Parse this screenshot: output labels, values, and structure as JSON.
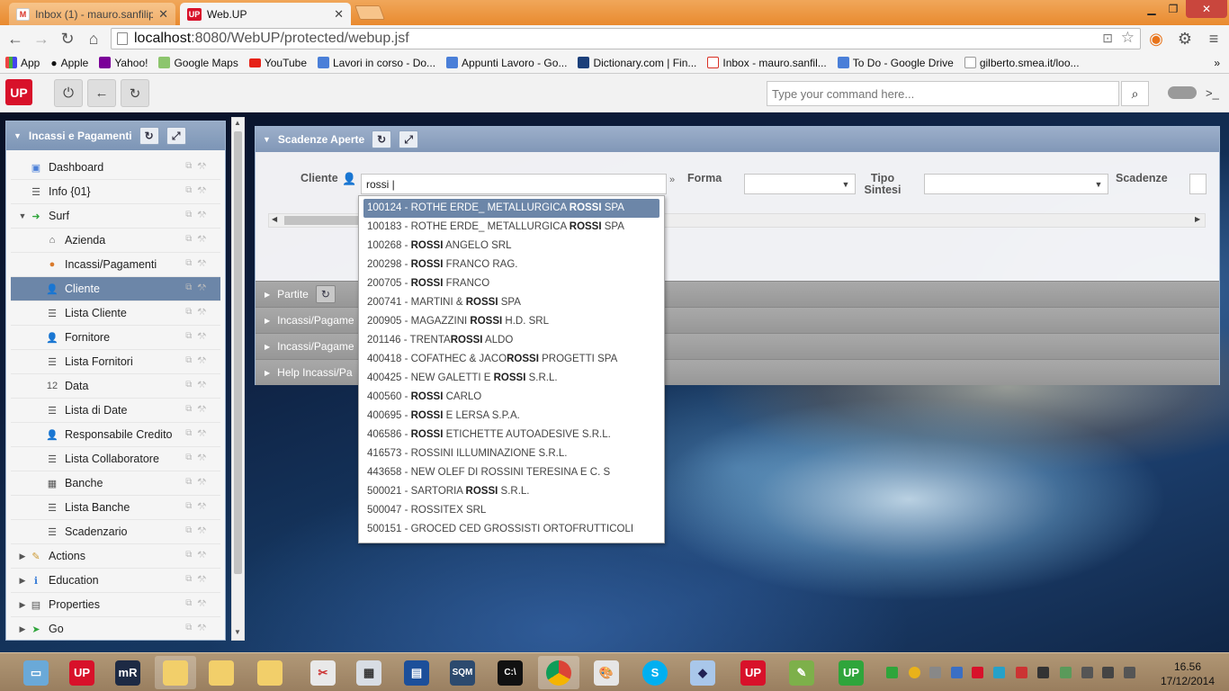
{
  "browser": {
    "tabs": [
      {
        "label": "Inbox (1) - mauro.sanfilipp",
        "icon": "M"
      },
      {
        "label": "Web.UP",
        "icon": "UP"
      }
    ],
    "url_host": "localhost",
    "url_rest": ":8080/WebUP/protected/webup.jsf",
    "bookmarks": [
      "App",
      "Apple",
      "Yahoo!",
      "Google Maps",
      "YouTube",
      "Lavori in corso - Do...",
      "Appunti Lavoro - Go...",
      "Dictionary.com | Fin...",
      "Inbox - mauro.sanfil...",
      "To Do - Google Drive",
      "gilberto.smea.it/loo..."
    ]
  },
  "app": {
    "logo": "UP",
    "command_placeholder": "Type your command here..."
  },
  "sidebar": {
    "title": "Incassi e Pagamenti",
    "items": [
      {
        "label": "Dashboard",
        "level": 1,
        "icon": "dashboard-icon"
      },
      {
        "label": "Info {01}",
        "level": 1,
        "icon": "list-icon"
      },
      {
        "label": "Surf",
        "level": 0,
        "icon": "surf-icon",
        "toggle": "▼"
      },
      {
        "label": "Azienda",
        "level": 2,
        "icon": "home-icon"
      },
      {
        "label": "Incassi/Pagamenti",
        "level": 2,
        "icon": "payments-icon"
      },
      {
        "label": "Cliente",
        "level": 2,
        "icon": "user-icon",
        "selected": true
      },
      {
        "label": "Lista Cliente",
        "level": 2,
        "icon": "list-icon"
      },
      {
        "label": "Fornitore",
        "level": 2,
        "icon": "user-icon"
      },
      {
        "label": "Lista Fornitori",
        "level": 2,
        "icon": "list-icon"
      },
      {
        "label": "Data",
        "level": 2,
        "icon": "calendar-icon"
      },
      {
        "label": "Lista di Date",
        "level": 2,
        "icon": "list-icon"
      },
      {
        "label": "Responsabile Credito",
        "level": 2,
        "icon": "user-icon"
      },
      {
        "label": "Lista Collaboratore",
        "level": 2,
        "icon": "list-icon"
      },
      {
        "label": "Banche",
        "level": 2,
        "icon": "bank-icon"
      },
      {
        "label": "Lista Banche",
        "level": 2,
        "icon": "list-icon"
      },
      {
        "label": "Scadenzario",
        "level": 2,
        "icon": "list-icon"
      },
      {
        "label": "Actions",
        "level": 0,
        "icon": "actions-icon",
        "toggle": "▶"
      },
      {
        "label": "Education",
        "level": 0,
        "icon": "info-icon",
        "toggle": "▶"
      },
      {
        "label": "Properties",
        "level": 0,
        "icon": "properties-icon",
        "toggle": "▶"
      },
      {
        "label": "Go",
        "level": 0,
        "icon": "go-icon",
        "toggle": "▶"
      }
    ]
  },
  "main": {
    "title": "Scadenze Aperte",
    "labels": {
      "cliente": "Cliente",
      "forma": "Forma",
      "tipo_sintesi": "Tipo Sintesi",
      "scadenze": "Scadenze"
    },
    "cliente_value": "rossi |",
    "subpanels": [
      "Partite",
      "Incassi/Pagame",
      "Incassi/Pagame",
      "Help Incassi/Pa"
    ]
  },
  "autocomplete": {
    "query": "ROSSI",
    "selected_index": 0,
    "items": [
      {
        "code": "100124",
        "pre": "ROTHE ERDE_ METALLURGICA ",
        "match": "ROSSI",
        "post": " SPA"
      },
      {
        "code": "100183",
        "pre": "ROTHE ERDE_ METALLURGICA ",
        "match": "ROSSI",
        "post": " SPA"
      },
      {
        "code": "100268",
        "pre": "",
        "match": "ROSSI",
        "post": " ANGELO SRL"
      },
      {
        "code": "200298",
        "pre": "",
        "match": "ROSSI",
        "post": " FRANCO RAG."
      },
      {
        "code": "200705",
        "pre": "",
        "match": "ROSSI",
        "post": " FRANCO"
      },
      {
        "code": "200741",
        "pre": "MARTINI & ",
        "match": "ROSSI",
        "post": " SPA"
      },
      {
        "code": "200905",
        "pre": "MAGAZZINI ",
        "match": "ROSSI",
        "post": " H.D. SRL"
      },
      {
        "code": "201146",
        "pre": "TRENTA",
        "match": "ROSSI",
        "post": " ALDO"
      },
      {
        "code": "400418",
        "pre": "COFATHEC & JACO",
        "match": "ROSSI",
        "post": " PROGETTI SPA"
      },
      {
        "code": "400425",
        "pre": "NEW GALETTI E ",
        "match": "ROSSI",
        "post": " S.R.L."
      },
      {
        "code": "400560",
        "pre": "",
        "match": "ROSSI",
        "post": " CARLO"
      },
      {
        "code": "400695",
        "pre": "",
        "match": "ROSSI",
        "post": " E LERSA S.P.A."
      },
      {
        "code": "406586",
        "pre": "",
        "match": "ROSSI",
        "post": " ETICHETTE AUTOADESIVE S.R.L."
      },
      {
        "code": "416573",
        "pre": "ROSSINI ILLUMINAZIONE S.R.L.",
        "match": "",
        "post": ""
      },
      {
        "code": "443658",
        "pre": "NEW OLEF DI ROSSINI TERESINA E C. S",
        "match": "",
        "post": ""
      },
      {
        "code": "500021",
        "pre": "SARTORIA ",
        "match": "ROSSI",
        "post": " S.R.L."
      },
      {
        "code": "500047",
        "pre": "ROSSITEX SRL",
        "match": "",
        "post": ""
      },
      {
        "code": "500151",
        "pre": "GROCED CED GROSSISTI ORTOFRUTTICOLI",
        "match": "",
        "post": ""
      }
    ]
  },
  "taskbar": {
    "time": "16.56",
    "date": "17/12/2014",
    "apps": [
      "UP",
      "mR",
      "SQM",
      "UP",
      "UP"
    ]
  },
  "colors": {
    "accent": "#6c86a8",
    "brand": "#d8112a",
    "chrome_orange": "#e98a2f"
  }
}
